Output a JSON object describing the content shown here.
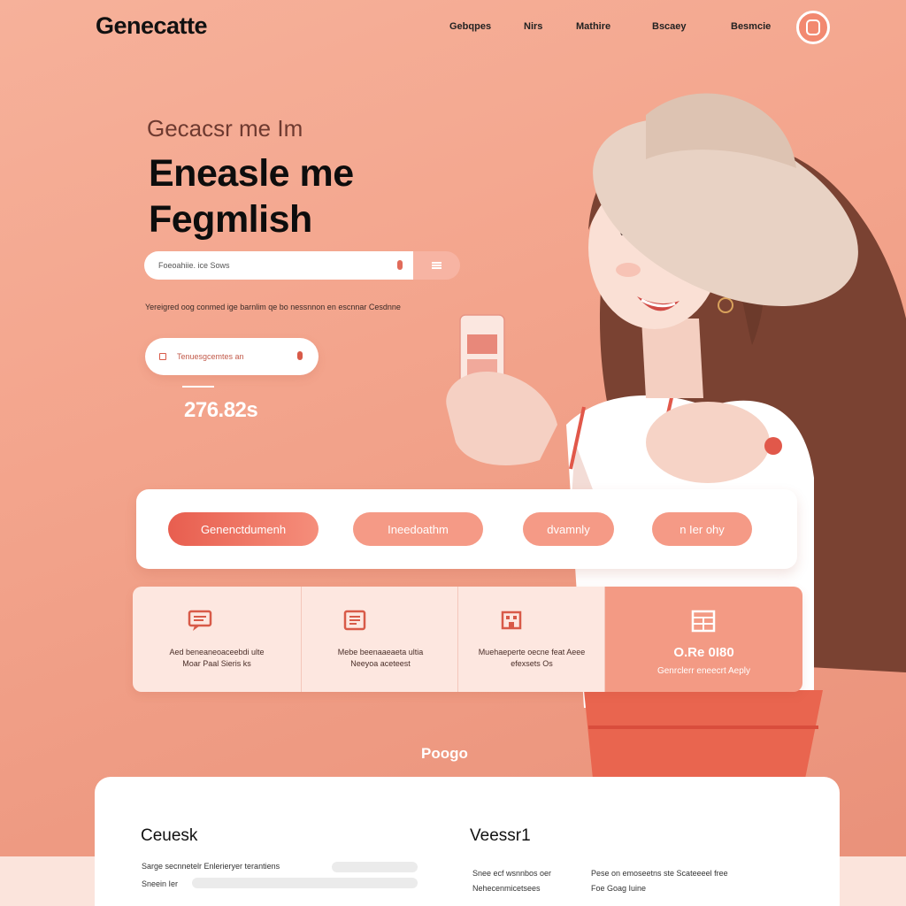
{
  "header": {
    "logo": "Genecatte",
    "nav": [
      "Gebqpes",
      "Nirs",
      "Mathire",
      "Bscaey",
      "Besmcie"
    ],
    "profile_icon": "profile-icon"
  },
  "hero": {
    "eyebrow": "Gecacsr me Im",
    "headline_line1": "Eneasle me",
    "headline_line2": "Fegmlish",
    "search": {
      "placeholder": "Foeoahiie. ice Sows",
      "button_icon": "menu-icon"
    },
    "description": "Yereigred oog conmed ige barnlim qe bo nessnnon en escnnar Cesdnne",
    "pill_input_value": "Tenuesgcemtes an",
    "price": "276.82s"
  },
  "tabs": [
    "Genenctdumenh",
    "Ineedoathm",
    "dvamnly",
    "n Ier ohy"
  ],
  "features": [
    {
      "icon": "chat-icon",
      "text": "Aed beneaneoaceebdi ulte Moar Paal Sieris ks"
    },
    {
      "icon": "document-icon",
      "text": "Mebe beenaaeaeta ultia Neeyoa aceteest"
    },
    {
      "icon": "building-icon",
      "text": "Muehaeperte oecne feat Aeee efexsets Os"
    },
    {
      "icon": "grid-icon",
      "title": "O.Re 0I80",
      "text": "Genrclerr eneecrt Aeply"
    }
  ],
  "brand_small": "Poogo",
  "bottom": {
    "left_heading": "Ceuesk",
    "left_lines": [
      "Sarge secnnetelr Enlerieryer terantiens",
      "Sneein Ier"
    ],
    "right_heading": "Veessr1",
    "right_col1": [
      "Snee ecf wsnnbos oer",
      "Nehecenmicetsees"
    ],
    "right_col2": [
      "Pese on emoseetns ste Scateeeel free",
      "Foe Goag Iuine"
    ]
  },
  "colors": {
    "accent": "#f28970",
    "accent_dark": "#e85e4f",
    "background": "#f3a48c",
    "card": "#fde7e0"
  }
}
